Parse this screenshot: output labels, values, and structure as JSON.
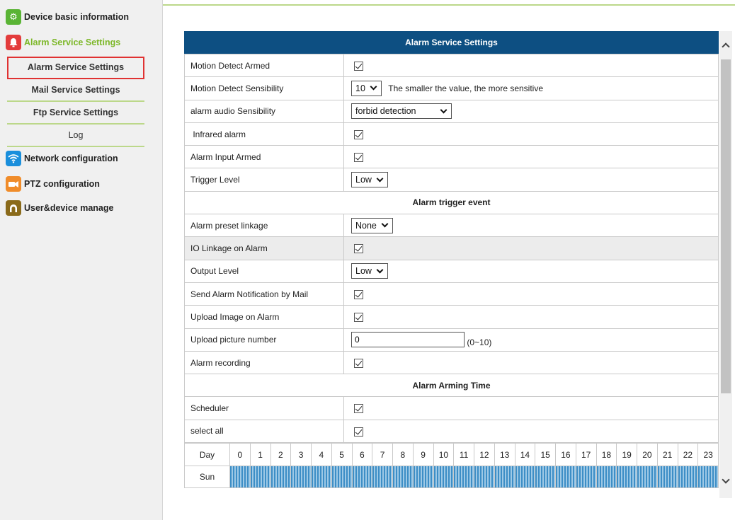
{
  "sidebar": {
    "device_basic": "Device basic information",
    "alarm_service": "Alarm Service Settings",
    "sub_items": [
      "Alarm Service Settings",
      "Mail Service Settings",
      "Ftp Service Settings",
      "Log"
    ],
    "network": "Network configuration",
    "ptz": "PTZ configuration",
    "user_device": "User&device manage",
    "icons": [
      "gear-icon",
      "alarm-bell-icon",
      "wifi-icon",
      "ptz-camera-icon",
      "user-icon"
    ],
    "colors": {
      "gear": "#5ab435",
      "bell": "#e33c3c",
      "wifi": "#1a8fdc",
      "ptz": "#f08c2a",
      "user": "#8a6a1a",
      "active": "#7cb728"
    }
  },
  "header": {
    "title": "Alarm Service Settings",
    "color": "#0d4f82"
  },
  "rows": {
    "motion_armed": {
      "label": "Motion Detect Armed",
      "checked": true
    },
    "motion_sens": {
      "label": "Motion Detect Sensibility",
      "value": "10",
      "hint": "The smaller the value, the more sensitive"
    },
    "audio_sens": {
      "label": "alarm audio Sensibility",
      "value": "forbid detection"
    },
    "infrared": {
      "label": " Infrared alarm",
      "checked": true
    },
    "input_armed": {
      "label": "Alarm Input Armed",
      "checked": true
    },
    "trigger_level": {
      "label": "Trigger Level",
      "value": "Low"
    },
    "section_event": "Alarm trigger event",
    "preset_linkage": {
      "label": "Alarm preset linkage",
      "value": "None"
    },
    "io_linkage": {
      "label": "IO Linkage on Alarm",
      "checked": true
    },
    "output_level": {
      "label": "Output Level",
      "value": "Low"
    },
    "send_mail": {
      "label": "Send Alarm Notification by Mail",
      "checked": true
    },
    "upload_image": {
      "label": "Upload Image on Alarm",
      "checked": true
    },
    "upload_number": {
      "label": "Upload picture number",
      "value": "0",
      "range": "(0~10)"
    },
    "recording": {
      "label": "Alarm recording",
      "checked": true
    },
    "section_arming": "Alarm Arming Time",
    "scheduler": {
      "label": "Scheduler",
      "checked": true
    },
    "select_all": {
      "label": "select all",
      "checked": true
    }
  },
  "schedule": {
    "day_header": "Day",
    "hours": [
      "0",
      "1",
      "2",
      "3",
      "4",
      "5",
      "6",
      "7",
      "8",
      "9",
      "10",
      "11",
      "12",
      "13",
      "14",
      "15",
      "16",
      "17",
      "18",
      "19",
      "20",
      "21",
      "22",
      "23"
    ],
    "days": [
      "Sun"
    ]
  }
}
